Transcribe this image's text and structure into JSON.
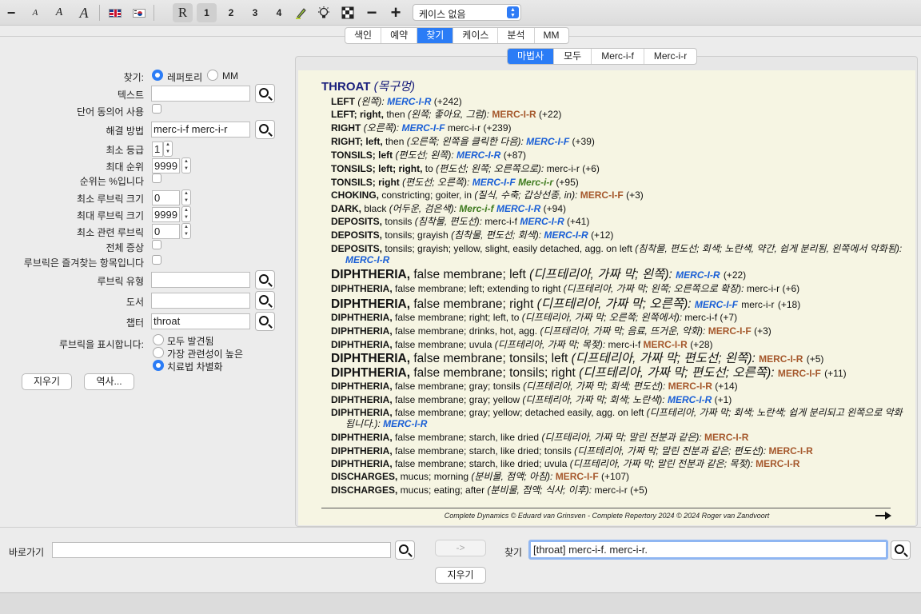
{
  "toolbar": {
    "font_decrease": "−",
    "font_a_small": "A",
    "font_a_medium": "A",
    "font_a_large": "A",
    "repertory_button": "R",
    "level_1": "1",
    "level_2": "2",
    "level_3": "3",
    "level_4": "4",
    "zoom_out": "−",
    "zoom_in": "+",
    "case_select": "케이스 없음"
  },
  "main_tabs": [
    "색인",
    "예약",
    "찾기",
    "케이스",
    "분석",
    "MM"
  ],
  "main_tab_active": "찾기",
  "form": {
    "find_label": "찾기:",
    "find_opt_repertory": "레퍼토리",
    "find_opt_mm": "MM",
    "text_label": "텍스트",
    "text_value": "",
    "synonyms_label": "단어 동의어 사용",
    "remedy_label": "해결 방법",
    "remedy_value": "merc-i-f merc-i-r",
    "min_grade_label": "최소 등급",
    "min_grade_value": "1",
    "max_rank_label": "최대 순위",
    "max_rank_value": "9999",
    "rank_percent_label": "순위는 %입니다",
    "min_rubric_size_label": "최소 루브릭 크기",
    "min_rubric_size_value": "0",
    "max_rubric_size_label": "최대 루브릭 크기",
    "max_rubric_size_value": "9999",
    "min_related_label": "최소 관련 루브릭",
    "min_related_value": "0",
    "all_symptoms_label": "전체 증상",
    "favorites_label": "루브릭은 즐겨찾는 항목입니다",
    "rubric_type_label": "루브릭 유형",
    "rubric_type_value": "",
    "book_label": "도서",
    "book_value": "",
    "chapter_label": "챕터",
    "chapter_value": "throat",
    "show_rubrics_label": "루브릭을 표시합니다:",
    "show_opt_all": "모두 발견됨",
    "show_opt_relevant": "가장 관련성이 높은",
    "show_opt_differentiate": "치료법 차별화",
    "clear_button": "지우기",
    "history_button": "역사..."
  },
  "sub_tabs": [
    "마법사",
    "모두",
    "Merc-i-f",
    "Merc-i-r"
  ],
  "sub_tab_active": "마법사",
  "results": {
    "title": "THROAT",
    "title_ko": "(목구멍)",
    "rows": [
      {
        "main": "LEFT",
        "rest": "",
        "ko": "(왼쪽):",
        "remedies": [
          {
            "name": "MERC-I-R",
            "style": "blue"
          }
        ],
        "count": "(+242)"
      },
      {
        "main": "LEFT; right,",
        "rest": " then",
        "ko": "(왼쪽; 좋아요, 그럼):",
        "remedies": [
          {
            "name": "MERC-I-R",
            "style": "brown"
          }
        ],
        "count": "(+22)"
      },
      {
        "main": "RIGHT",
        "rest": "",
        "ko": "(오른쪽):",
        "remedies": [
          {
            "name": "MERC-I-F",
            "style": "blue"
          },
          {
            "name": "merc-i-r",
            "style": "plain"
          }
        ],
        "count": "(+239)"
      },
      {
        "main": "RIGHT; left,",
        "rest": " then",
        "ko": "(오른쪽; 왼쪽을 클릭한 다음):",
        "remedies": [
          {
            "name": "MERC-I-F",
            "style": "blue"
          }
        ],
        "count": "(+39)"
      },
      {
        "main": "TONSILS; left",
        "rest": "",
        "ko": "(편도선; 왼쪽):",
        "remedies": [
          {
            "name": "MERC-I-R",
            "style": "blue"
          }
        ],
        "count": "(+87)"
      },
      {
        "main": "TONSILS; left; right,",
        "rest": " to",
        "ko": "(편도선; 왼쪽; 오른쪽으로):",
        "remedies": [
          {
            "name": "merc-i-r",
            "style": "plain"
          }
        ],
        "count": "(+6)"
      },
      {
        "main": "TONSILS; right",
        "rest": "",
        "ko": "(편도선; 오른쪽):",
        "remedies": [
          {
            "name": "MERC-I-F",
            "style": "blue"
          },
          {
            "name": "Merc-i-r",
            "style": "green"
          }
        ],
        "count": "(+95)"
      },
      {
        "main": "CHOKING,",
        "rest": " constricting; goiter, in",
        "ko": "(질식, 수축; 갑상선종, in):",
        "remedies": [
          {
            "name": "MERC-I-F",
            "style": "brown"
          }
        ],
        "count": "(+3)"
      },
      {
        "main": "DARK,",
        "rest": " black",
        "ko": "(어두운, 검은색):",
        "remedies": [
          {
            "name": "Merc-i-f",
            "style": "green"
          },
          {
            "name": "MERC-I-R",
            "style": "blue"
          }
        ],
        "count": "(+94)"
      },
      {
        "main": "DEPOSITS,",
        "rest": " tonsils",
        "ko": "(침착물, 편도선):",
        "remedies": [
          {
            "name": "merc-i-f",
            "style": "plain"
          },
          {
            "name": "MERC-I-R",
            "style": "blue"
          }
        ],
        "count": "(+41)"
      },
      {
        "main": "DEPOSITS,",
        "rest": " tonsils; grayish",
        "ko": "(침착물, 편도선; 회색):",
        "remedies": [
          {
            "name": "MERC-I-R",
            "style": "blue"
          }
        ],
        "count": "(+12)"
      },
      {
        "main": "DEPOSITS,",
        "rest": " tonsils; grayish; yellow, slight, easily detached, agg. on left",
        "ko": "(침착물, 편도선; 회색; 노란색, 약간, 쉽게 분리됨, 왼쪽에서 악화됨):",
        "remedies": [
          {
            "name": "MERC-I-R",
            "style": "blue"
          }
        ],
        "count": ""
      },
      {
        "main": "DIPHTHERIA,",
        "rest": " false membrane; left",
        "ko": "(디프테리아, 가짜 막; 왼쪽):",
        "remedies": [
          {
            "name": "MERC-I-R",
            "style": "blue"
          }
        ],
        "count": "(+22)"
      },
      {
        "main": "DIPHTHERIA,",
        "rest": " false membrane; left; extending to right",
        "ko": "(디프테리아, 가짜 막; 왼쪽; 오른쪽으로 확장):",
        "remedies": [
          {
            "name": "merc-i-r",
            "style": "plain"
          }
        ],
        "count": "(+6)"
      },
      {
        "main": "DIPHTHERIA,",
        "rest": " false membrane; right",
        "ko": "(디프테리아, 가짜 막; 오른쪽):",
        "remedies": [
          {
            "name": "MERC-I-F",
            "style": "blue"
          },
          {
            "name": "merc-i-r",
            "style": "plain"
          }
        ],
        "count": "(+18)"
      },
      {
        "main": "DIPHTHERIA,",
        "rest": " false membrane; right; left, to",
        "ko": "(디프테리아, 가짜 막; 오른쪽; 왼쪽에서):",
        "remedies": [
          {
            "name": "merc-i-f",
            "style": "plain"
          }
        ],
        "count": "(+7)"
      },
      {
        "main": "DIPHTHERIA,",
        "rest": " false membrane; drinks, hot, agg.",
        "ko": "(디프테리아, 가짜 막; 음료, 뜨거운, 악화):",
        "remedies": [
          {
            "name": "MERC-I-F",
            "style": "brown"
          }
        ],
        "count": "(+3)"
      },
      {
        "main": "DIPHTHERIA,",
        "rest": " false membrane; uvula",
        "ko": "(디프테리아, 가짜 막; 목젖):",
        "remedies": [
          {
            "name": "merc-i-f",
            "style": "plain"
          },
          {
            "name": "MERC-I-R",
            "style": "brown"
          }
        ],
        "count": "(+28)"
      },
      {
        "main": "DIPHTHERIA,",
        "rest": " false membrane; tonsils; left",
        "ko": "(디프테리아, 가짜 막; 편도선; 왼쪽):",
        "remedies": [
          {
            "name": "MERC-I-R",
            "style": "brown"
          }
        ],
        "count": "(+5)"
      },
      {
        "main": "DIPHTHERIA,",
        "rest": " false membrane; tonsils; right",
        "ko": "(디프테리아, 가짜 막; 편도선; 오른쪽):",
        "remedies": [
          {
            "name": "MERC-I-F",
            "style": "brown"
          }
        ],
        "count": "(+11)"
      },
      {
        "main": "DIPHTHERIA,",
        "rest": " false membrane; gray; tonsils",
        "ko": "(디프테리아, 가짜 막; 회색; 편도선):",
        "remedies": [
          {
            "name": "MERC-I-R",
            "style": "brown"
          }
        ],
        "count": "(+14)"
      },
      {
        "main": "DIPHTHERIA,",
        "rest": " false membrane; gray; yellow",
        "ko": "(디프테리아, 가짜 막; 회색; 노란색):",
        "remedies": [
          {
            "name": "MERC-I-R",
            "style": "blue"
          }
        ],
        "count": "(+1)"
      },
      {
        "main": "DIPHTHERIA,",
        "rest": " false membrane; gray; yellow; detached easily, agg. on left",
        "ko": "(디프테리아, 가짜 막; 회색; 노란색; 쉽게 분리되고 왼쪽으로 악화됩니다.):",
        "remedies": [
          {
            "name": "MERC-I-R",
            "style": "blue"
          }
        ],
        "count": ""
      },
      {
        "main": "DIPHTHERIA,",
        "rest": " false membrane; starch, like dried",
        "ko": "(디프테리아, 가짜 막; 말린 전분과 같은):",
        "remedies": [
          {
            "name": "MERC-I-R",
            "style": "brown"
          }
        ],
        "count": ""
      },
      {
        "main": "DIPHTHERIA,",
        "rest": " false membrane; starch, like dried; tonsils",
        "ko": "(디프테리아, 가짜 막; 말린 전분과 같은; 편도선):",
        "remedies": [
          {
            "name": "MERC-I-R",
            "style": "brown"
          }
        ],
        "count": ""
      },
      {
        "main": "DIPHTHERIA,",
        "rest": " false membrane; starch, like dried; uvula",
        "ko": "(디프테리아, 가짜 막; 말린 전분과 같은; 목젖):",
        "remedies": [
          {
            "name": "MERC-I-R",
            "style": "brown"
          }
        ],
        "count": ""
      },
      {
        "main": "DISCHARGES,",
        "rest": " mucus; morning",
        "ko": "(분비물, 점액; 아침):",
        "remedies": [
          {
            "name": "MERC-I-F",
            "style": "brown"
          }
        ],
        "count": "(+107)"
      },
      {
        "main": "DISCHARGES,",
        "rest": " mucus; eating; after",
        "ko": "(분비물, 점액; 식사; 이후):",
        "remedies": [
          {
            "name": "merc-i-r",
            "style": "plain"
          }
        ],
        "count": "(+5)"
      }
    ],
    "footer": "Complete Dynamics © Eduard van Grinsven  -  Complete Repertory 2024 © 2024 Roger van Zandvoort"
  },
  "bottom": {
    "goto_label": "바로가기",
    "goto_value": "",
    "arrow_button": "->",
    "find_label": "찾기",
    "find_value": "[throat] merc-i-f. merc-i-r.",
    "clear_button": "지우기"
  }
}
